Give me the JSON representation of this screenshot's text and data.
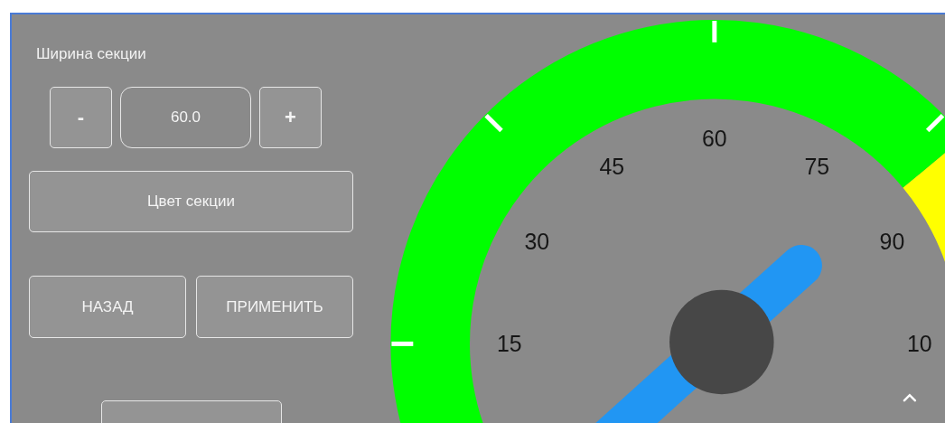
{
  "title": "Ширина секции",
  "width_stepper": {
    "decrement": "-",
    "value": "60.0",
    "increment": "+"
  },
  "color_button": "Цвет секции",
  "buttons": [
    "НАЗАД",
    "ПРИМЕНИТЬ"
  ],
  "gauge": {
    "labels": [
      "15",
      "30",
      "45",
      "60",
      "75",
      "90",
      "10"
    ],
    "zones": [
      {
        "color": "#00ff00"
      },
      {
        "color": "#ffff00"
      }
    ],
    "level": 0.7
  }
}
